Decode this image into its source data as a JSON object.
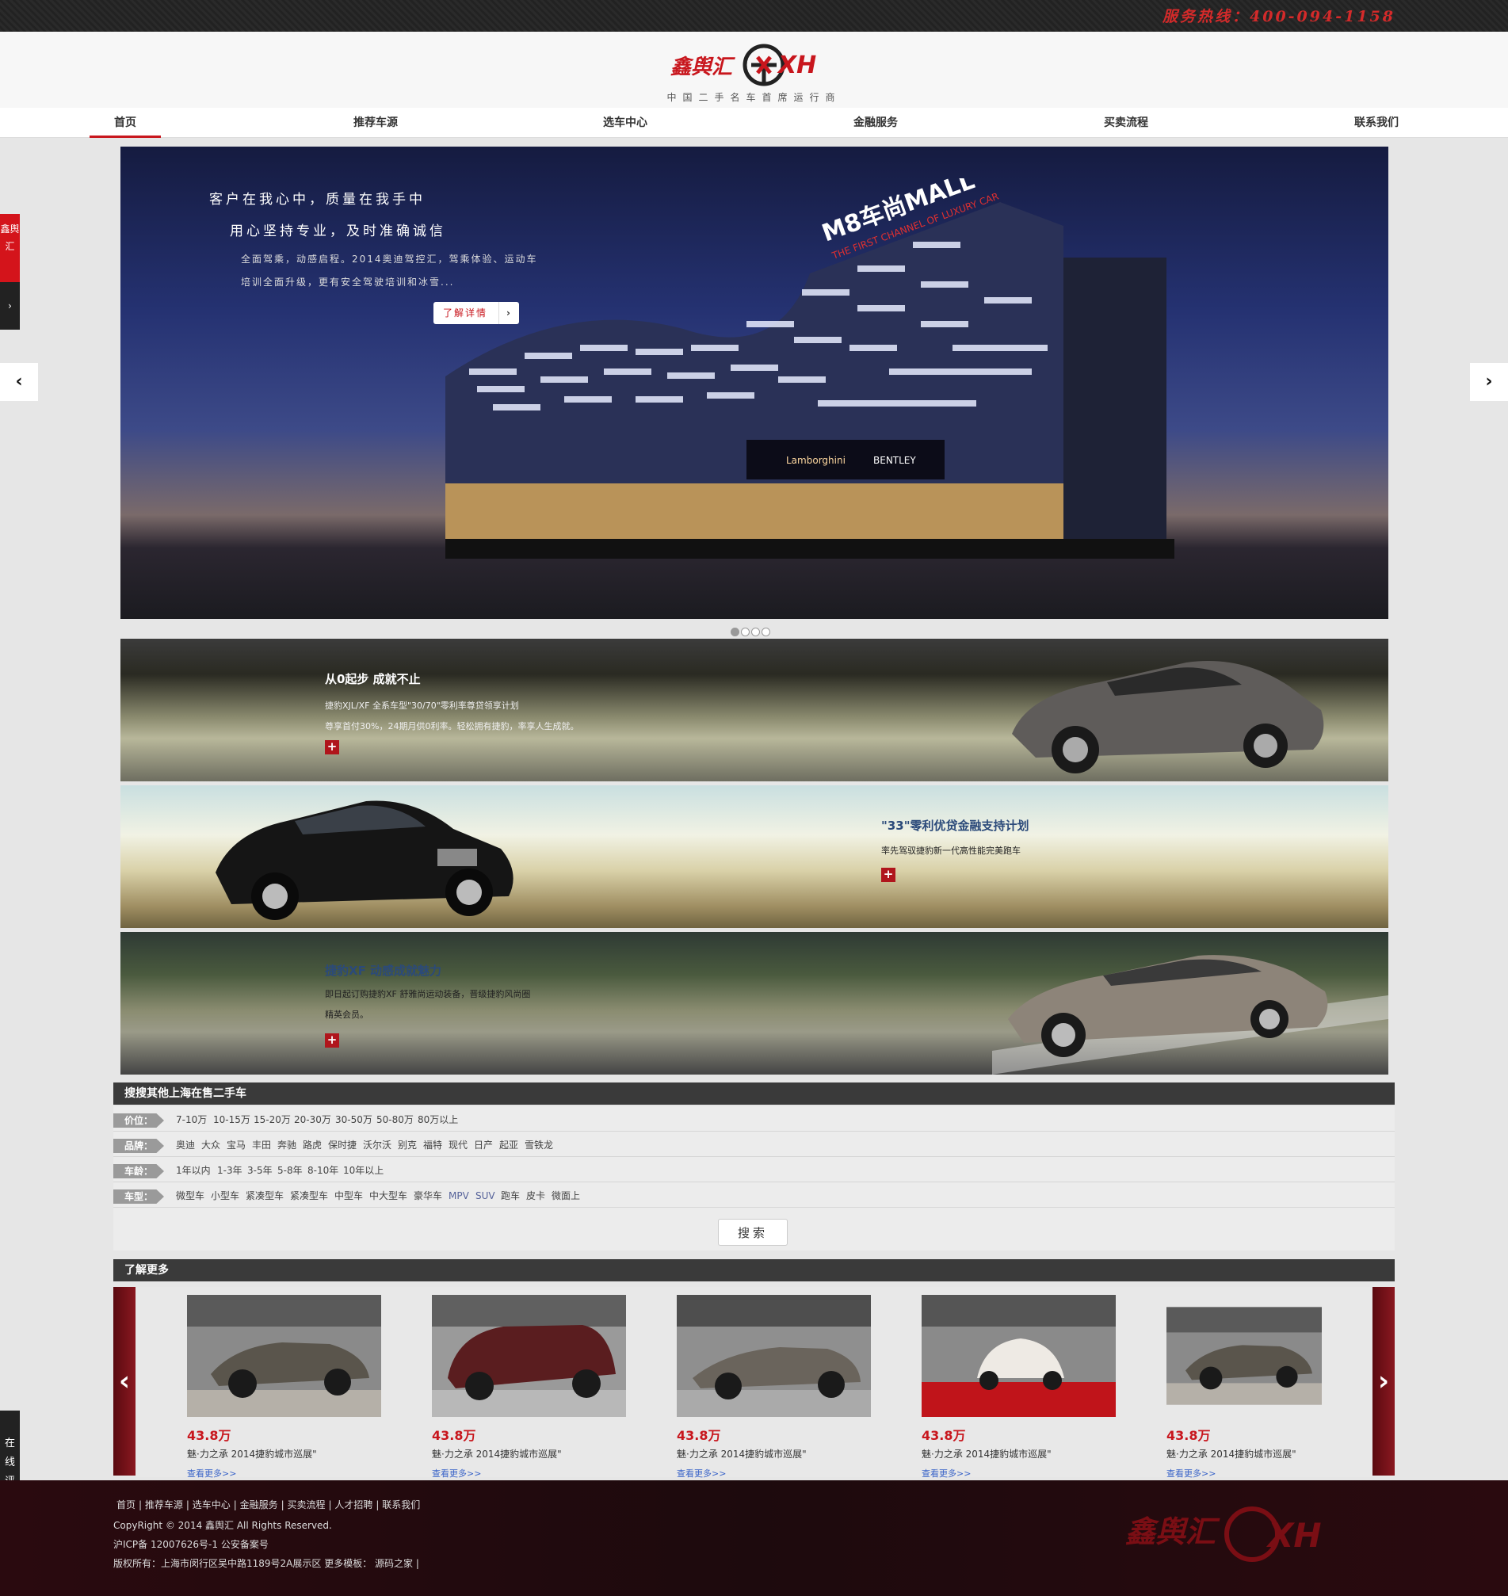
{
  "topbar": {
    "hotline": "服务热线：400-094-1158"
  },
  "header": {
    "logo_text": "鑫舆汇",
    "logo_mark": "XH",
    "slogan": "中国二手名车首席运行商"
  },
  "nav": {
    "items": [
      "首页",
      "推荐车源",
      "选车中心",
      "金融服务",
      "买卖流程",
      "联系我们"
    ],
    "active": 0
  },
  "banner": {
    "line1": "客户在我心中，质量在我手中",
    "line2": "用心坚持专业，及时准确诚信",
    "desc": "全面驾乘，动感启程。2014奥迪驾控汇，驾乘体验、运动车培训全面升级，更有安全驾驶培训和冰雪...",
    "button": "了解详情",
    "button_arrow": "›",
    "sign_main": "M8车尚MALL",
    "sign_sub": "THE FIRST CHANNEL OF LUXURY CAR",
    "store1": "Lamborghini",
    "store2": "BENTLEY",
    "dots": 4,
    "active_dot": 0,
    "prev": "‹",
    "next": "›"
  },
  "promos": [
    {
      "title": "从0起步 成就不止",
      "desc1": "捷豹XJL/XF 全系车型\"30/70\"零利率尊贷领享计划",
      "desc2": "尊享首付30%，24期月供0利率。轻松拥有捷豹，率享人生成就。",
      "plus": "+"
    },
    {
      "title": "\"33\"零利优贷金融支持计划",
      "desc1": "率先驾驭捷豹新一代高性能完美跑车",
      "desc2": "",
      "plus": "+"
    },
    {
      "title": "捷豹XF 动感成就魅力",
      "desc1": "即日起订购捷豹XF 舒雅尚运动装备，晋级捷豹风尚圈",
      "desc2": "精英会员。",
      "plus": "+"
    }
  ],
  "search": {
    "title": "搜搜其他上海在售二手车",
    "rows": [
      {
        "label": "价位：",
        "options": [
          "7-10万",
          "10-15万",
          "15-20万",
          "20-30万",
          "30-50万",
          "50-80万",
          "80万以上"
        ]
      },
      {
        "label": "品牌：",
        "options": [
          "奥迪",
          "大众",
          "宝马",
          "丰田",
          "奔驰",
          "路虎",
          "保时捷",
          "沃尔沃",
          "别克",
          "福特",
          "现代",
          "日产",
          "起亚",
          "雪铁龙"
        ]
      },
      {
        "label": "车龄：",
        "options": [
          "1年以内",
          "1-3年",
          "3-5年",
          "5-8年",
          "8-10年",
          "10年以上"
        ]
      },
      {
        "label": "车型：",
        "options": [
          "微型车",
          "小型车",
          "紧凑型车",
          "紧凑型车",
          "中型车",
          "中大型车",
          "豪华车",
          "MPV",
          "SUV",
          "跑车",
          "皮卡",
          "微面上"
        ]
      }
    ],
    "button": "搜索"
  },
  "more": {
    "title": "了解更多",
    "prev": "‹",
    "next": "›",
    "cards": [
      {
        "price": "43.8万",
        "title": "魅·力之承 2014捷豹城市巡展\"",
        "more": "查看更多>>"
      },
      {
        "price": "43.8万",
        "title": "魅·力之承 2014捷豹城市巡展\"",
        "more": "查看更多>>"
      },
      {
        "price": "43.8万",
        "title": "魅·力之承 2014捷豹城市巡展\"",
        "more": "查看更多>>"
      },
      {
        "price": "43.8万",
        "title": "魅·力之承 2014捷豹城市巡展\"",
        "more": "查看更多>>"
      },
      {
        "price": "43.8万",
        "title": "魅·力之承 2014捷豹城市巡展\"",
        "more": "查看更多>>"
      }
    ]
  },
  "footer": {
    "links": [
      "首页",
      "推荐车源",
      "选车中心",
      "金融服务",
      "买卖流程",
      "人才招聘",
      "联系我们"
    ],
    "copyright": "CopyRight © 2014 鑫舆汇 All Rights Reserved.",
    "icp": "沪ICP备 12007626号-1 公安备案号",
    "address": "版权所有：上海市闵行区吴中路1189号2A展示区 更多模板：  源码之家 |",
    "logo_text": "鑫舆汇",
    "logo_mark": "XH"
  },
  "side": {
    "brand_tab": "鑫舆汇",
    "brand_tab_arrow": "›",
    "eval_tab": "在线评估"
  },
  "colors": {
    "brand_red": "#c8161d",
    "dark": "#3a3a3a",
    "link_blue": "#3a64c8"
  }
}
